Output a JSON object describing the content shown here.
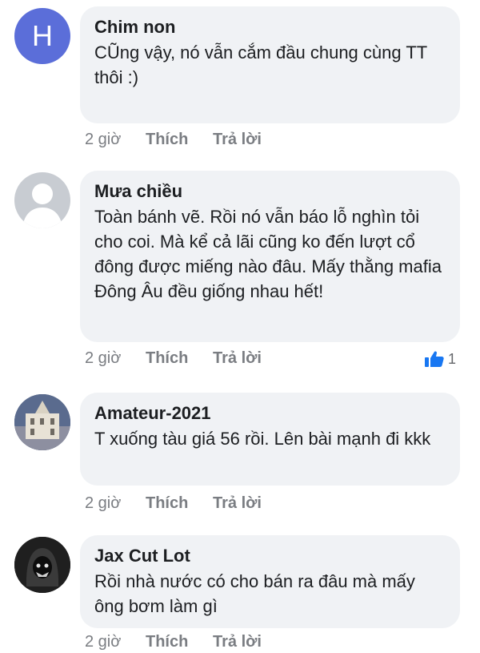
{
  "comments": [
    {
      "author": "Chim non",
      "avatar_letter": "H",
      "text": "CŨng vậy, nó vẫn cắm đầu chung cùng TT thôi :)",
      "time": "2 giờ",
      "like_label": "Thích",
      "reply_label": "Trả lời"
    },
    {
      "author": "Mưa chiều",
      "text": "Toàn bánh vẽ. Rồi nó vẫn báo lỗ nghìn tỏi cho coi. Mà kể cả lãi cũng ko đến lượt cổ đông được miếng nào đâu. Mấy thằng mafia Đông Âu đều giống nhau hết!",
      "time": "2 giờ",
      "like_label": "Thích",
      "reply_label": "Trả lời",
      "reaction_count": "1"
    },
    {
      "author": "Amateur-2021",
      "text": "T xuống tàu giá 56 rồi. Lên bài mạnh đi kkk",
      "time": "2 giờ",
      "like_label": "Thích",
      "reply_label": "Trả lời"
    },
    {
      "author": "Jax Cut Lot",
      "text": "Rồi nhà nước có cho bán ra đâu mà mấy ông bơm làm gì",
      "time": "2 giờ",
      "like_label": "Thích",
      "reply_label": "Trả lời"
    }
  ],
  "colors": {
    "bubble": "#f0f2f5",
    "meta": "#7a7d82",
    "like_blue": "#1877f2",
    "letter_avatar": "#5b6ed9"
  }
}
